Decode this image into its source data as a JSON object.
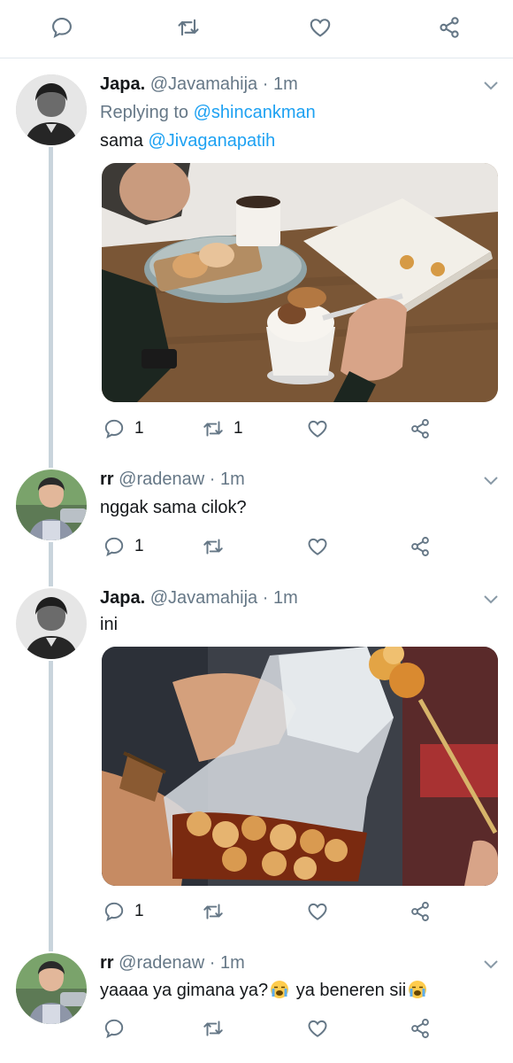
{
  "top_actions": {
    "reply_icon": "reply-icon",
    "retweet_icon": "retweet-icon",
    "like_icon": "heart-icon",
    "share_icon": "share-icon"
  },
  "tweets": [
    {
      "name": "Japa.",
      "handle": "@Javamahija",
      "time": "1m",
      "replying_prefix": "Replying to",
      "replying_handle": "@shincankman",
      "text": "sama",
      "mention": "@Jivaganapatih",
      "media": "photo of ice cream dessert with cookies on a wooden table",
      "reply_count": "1",
      "retweet_count": "1",
      "like_count": ""
    },
    {
      "name": "rr",
      "handle": "@radenaw",
      "time": "1m",
      "text": "nggak sama cilok?",
      "reply_count": "1",
      "retweet_count": "",
      "like_count": ""
    },
    {
      "name": "Japa.",
      "handle": "@Javamahija",
      "time": "1m",
      "text": "ini",
      "media": "photo of cilok in a plastic bag with sauce",
      "reply_count": "1",
      "retweet_count": "",
      "like_count": ""
    },
    {
      "name": "rr",
      "handle": "@radenaw",
      "time": "1m",
      "text_part1": "yaaaa ya gimana ya?",
      "text_part2": " ya beneren sii",
      "emoji": "loudly-crying-face",
      "reply_count": "",
      "retweet_count": "",
      "like_count": ""
    }
  ],
  "separator": " · "
}
